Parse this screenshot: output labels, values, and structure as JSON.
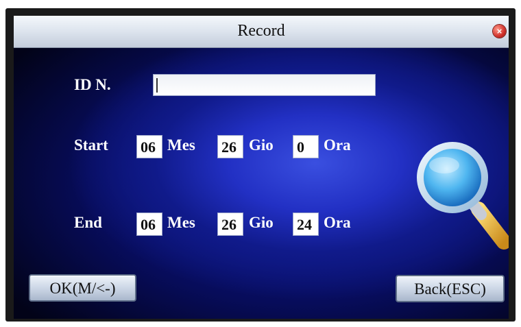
{
  "window": {
    "title": "Record",
    "close_icon": "close-icon"
  },
  "form": {
    "id_label": "ID N.",
    "id_value": "",
    "start": {
      "label": "Start",
      "month": "06",
      "month_label": "Mes",
      "day": "26",
      "day_label": "Gio",
      "hour": "0",
      "hour_label": "Ora"
    },
    "end": {
      "label": "End",
      "month": "06",
      "month_label": "Mes",
      "day": "26",
      "day_label": "Gio",
      "hour": "24",
      "hour_label": "Ora"
    }
  },
  "buttons": {
    "ok_label": "OK(M/<-)",
    "back_label": "Back(ESC)"
  },
  "decor": {
    "magnifier_icon": "magnifier-icon"
  },
  "colors": {
    "title_bar": "#dfe6ef",
    "background": "#1a2ab0",
    "text": "#ffffff",
    "close": "#d0302a"
  }
}
